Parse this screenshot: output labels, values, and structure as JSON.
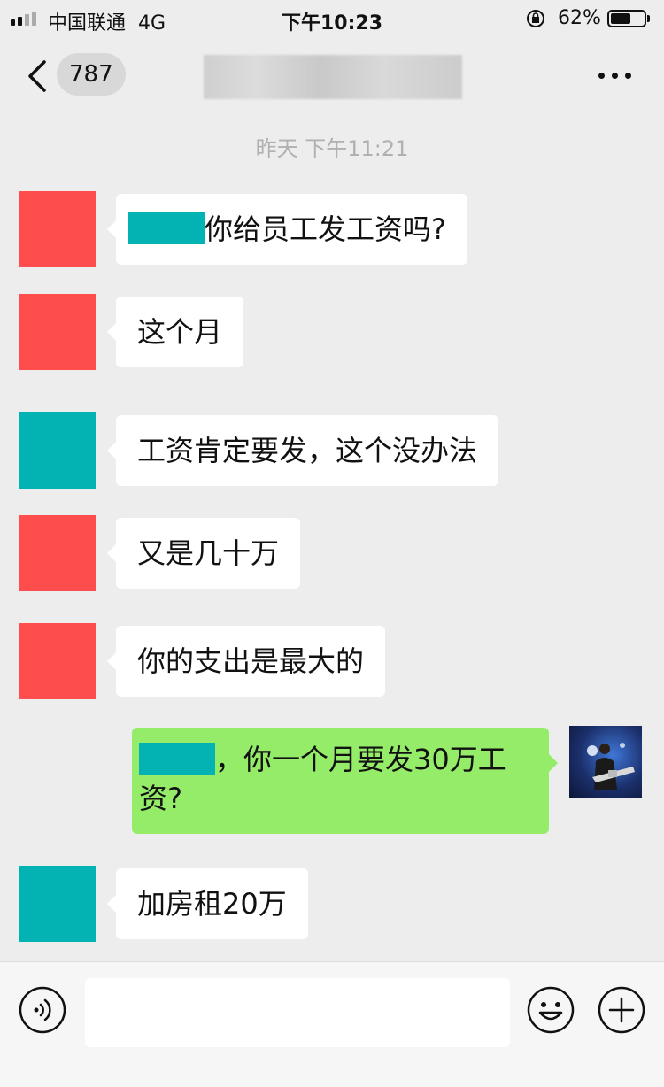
{
  "status_bar": {
    "carrier": "中国联通",
    "network": "4G",
    "time": "下午10:23",
    "battery_percent_label": "62%",
    "battery_level": 0.62,
    "icons": [
      "signal-icon",
      "orientation-lock-icon",
      "battery-icon"
    ]
  },
  "nav": {
    "back_icon": "chevron-left-icon",
    "unread_count": "787",
    "more_icon": "ellipsis-icon"
  },
  "chat": {
    "timestamp": "昨天 下午11:21",
    "messages": [
      {
        "sender": "red",
        "text": "你给员工发工资吗?"
      },
      {
        "sender": "red",
        "text": "这个月"
      },
      {
        "sender": "teal",
        "text": "工资肯定要发，这个没办法"
      },
      {
        "sender": "red",
        "text": "又是几十万"
      },
      {
        "sender": "red",
        "text": "你的支出是最大的"
      },
      {
        "sender": "self",
        "text": "，你一个月要发30万工资?"
      },
      {
        "sender": "teal",
        "text": "加房租20万"
      }
    ]
  },
  "input_bar": {
    "voice_icon": "voice-icon",
    "input_value": "",
    "emoji_icon": "emoji-icon",
    "plus_icon": "plus-icon"
  },
  "colors": {
    "red_avatar": "#fd4d4d",
    "teal_avatar": "#03b3b3",
    "self_bubble": "#95ec69",
    "background": "#ededed"
  }
}
